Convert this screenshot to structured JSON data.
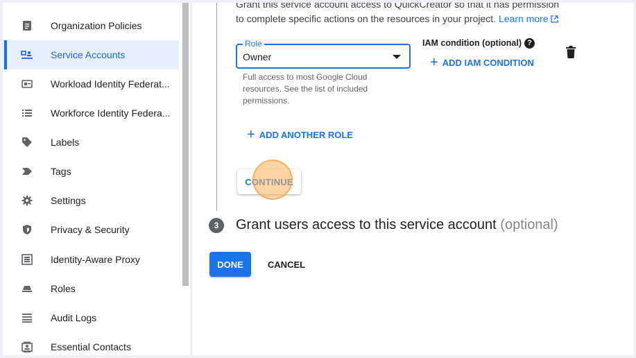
{
  "sidebar": {
    "items": [
      {
        "label": "Organization Policies",
        "icon": "document-icon"
      },
      {
        "label": "Service Accounts",
        "icon": "service-account-icon",
        "active": true
      },
      {
        "label": "Workload Identity Federat...",
        "icon": "id-card-icon"
      },
      {
        "label": "Workforce Identity Federa...",
        "icon": "list-icon"
      },
      {
        "label": "Labels",
        "icon": "label-icon"
      },
      {
        "label": "Tags",
        "icon": "tag-icon"
      },
      {
        "label": "Settings",
        "icon": "gear-icon"
      },
      {
        "label": "Privacy & Security",
        "icon": "shield-icon"
      },
      {
        "label": "Identity-Aware Proxy",
        "icon": "proxy-icon"
      },
      {
        "label": "Roles",
        "icon": "roles-icon"
      },
      {
        "label": "Audit Logs",
        "icon": "audit-log-icon"
      },
      {
        "label": "Essential Contacts",
        "icon": "contacts-icon"
      }
    ]
  },
  "step2": {
    "intro_text": "Grant this service account access to QuickCreator so that it has permission to complete specific actions on the resources in your project.",
    "learn_more": "Learn more",
    "role": {
      "label": "Role",
      "value": "Owner",
      "help": "Full access to most Google Cloud resources. See the list of included permissions."
    },
    "iam_condition": {
      "title": "IAM condition (optional)",
      "help_glyph": "?",
      "add_label": "ADD IAM CONDITION"
    },
    "add_role_label": "ADD ANOTHER ROLE",
    "continue_label": "CONTINUE"
  },
  "step3": {
    "number": "3",
    "title": "Grant users access to this service account",
    "optional": "(optional)"
  },
  "actions": {
    "done_label": "DONE",
    "cancel_label": "CANCEL"
  },
  "colors": {
    "accent": "#1a73e8",
    "active_nav_bg": "#e8f0fe",
    "click_indicator": "#fbb05a"
  }
}
